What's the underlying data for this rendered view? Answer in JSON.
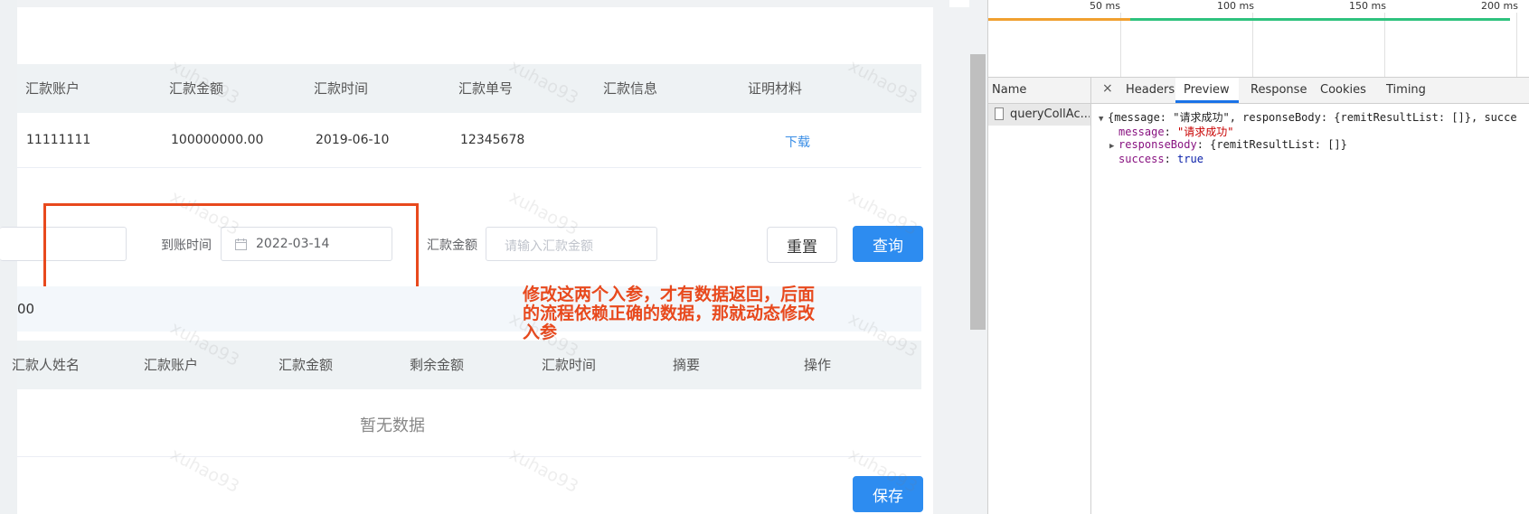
{
  "table1": {
    "headers": [
      "汇款账户",
      "汇款金额",
      "汇款时间",
      "汇款单号",
      "汇款信息",
      "证明材料"
    ],
    "row": {
      "account": "11111111",
      "amount": "100000000.00",
      "time": "2019-06-10",
      "number": "12345678",
      "info": "",
      "proof_link": "下载"
    }
  },
  "filters": {
    "arrival_time_label": "到账时间",
    "arrival_time_value": "2022-03-14",
    "amount_label": "汇款金额",
    "amount_placeholder": "请输入汇款金额",
    "reset_label": "重置",
    "query_label": "查询"
  },
  "summary": {
    "text": "00"
  },
  "table2": {
    "headers": [
      "汇款人姓名",
      "汇款账户",
      "汇款金额",
      "剩余金额",
      "汇款时间",
      "摘要",
      "操作"
    ],
    "empty_text": "暂无数据"
  },
  "save_label": "保存",
  "annotation": "修改这两个入参，才有数据返回，后面的流程依赖正确的数据，那就动态修改入参",
  "watermark": "xuhao93",
  "devtools": {
    "timeline_ticks": [
      "50 ms",
      "100 ms",
      "150 ms",
      "200 ms"
    ],
    "name_header": "Name",
    "request_name": "queryCollAc...",
    "tabs": [
      "Headers",
      "Preview",
      "Response",
      "Cookies",
      "Timing"
    ],
    "close_symbol": "×",
    "preview": {
      "summary_line": "{message: \"请求成功\", responseBody: {remitResultList: []}, succe",
      "message_key": "message",
      "message_value": "\"请求成功\"",
      "response_key": "responseBody",
      "response_value": "{remitResultList: []}",
      "success_key": "success",
      "success_value": "true"
    }
  },
  "colors": {
    "primary_button": "#2d8cf0",
    "annotation_red": "#e8491d",
    "link_blue": "#3a8ee6",
    "tab_active": "#1a73e8"
  }
}
